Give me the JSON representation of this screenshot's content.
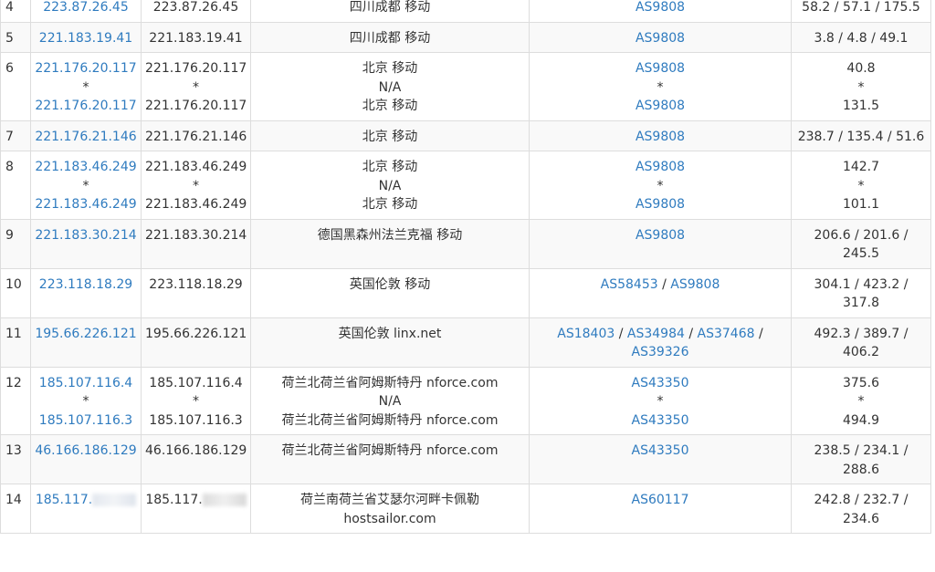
{
  "rows": [
    {
      "hop": "4",
      "ip_link": [
        "223.87.26.45"
      ],
      "ip": [
        "223.87.26.45"
      ],
      "location": [
        "四川成都 移动"
      ],
      "asn": [
        [
          "AS9808"
        ]
      ],
      "latency": [
        "58.2 / 57.1 / 175.5"
      ]
    },
    {
      "hop": "5",
      "ip_link": [
        "221.183.19.41"
      ],
      "ip": [
        "221.183.19.41"
      ],
      "location": [
        "四川成都 移动"
      ],
      "asn": [
        [
          "AS9808"
        ]
      ],
      "latency": [
        "3.8 / 4.8 / 49.1"
      ]
    },
    {
      "hop": "6",
      "ip_link": [
        "221.176.20.117",
        "*",
        "221.176.20.117"
      ],
      "ip": [
        "221.176.20.117",
        "*",
        "221.176.20.117"
      ],
      "location": [
        "北京 移动",
        "N/A",
        "北京 移动"
      ],
      "asn": [
        [
          "AS9808"
        ],
        [
          "*"
        ],
        [
          "AS9808"
        ]
      ],
      "latency": [
        "40.8",
        "*",
        "131.5"
      ]
    },
    {
      "hop": "7",
      "ip_link": [
        "221.176.21.146"
      ],
      "ip": [
        "221.176.21.146"
      ],
      "location": [
        "北京 移动"
      ],
      "asn": [
        [
          "AS9808"
        ]
      ],
      "latency": [
        "238.7 / 135.4 / 51.6"
      ]
    },
    {
      "hop": "8",
      "ip_link": [
        "221.183.46.249",
        "*",
        "221.183.46.249"
      ],
      "ip": [
        "221.183.46.249",
        "*",
        "221.183.46.249"
      ],
      "location": [
        "北京 移动",
        "N/A",
        "北京 移动"
      ],
      "asn": [
        [
          "AS9808"
        ],
        [
          "*"
        ],
        [
          "AS9808"
        ]
      ],
      "latency": [
        "142.7",
        "*",
        "101.1"
      ]
    },
    {
      "hop": "9",
      "ip_link": [
        "221.183.30.214"
      ],
      "ip": [
        "221.183.30.214"
      ],
      "location": [
        "德国黑森州法兰克福 移动"
      ],
      "asn": [
        [
          "AS9808"
        ]
      ],
      "latency": [
        "206.6 / 201.6 /",
        "245.5"
      ]
    },
    {
      "hop": "10",
      "ip_link": [
        "223.118.18.29"
      ],
      "ip": [
        "223.118.18.29"
      ],
      "location": [
        "英国伦敦 移动"
      ],
      "asn": [
        [
          "AS58453",
          "AS9808"
        ]
      ],
      "latency": [
        "304.1 / 423.2 /",
        "317.8"
      ]
    },
    {
      "hop": "11",
      "ip_link": [
        "195.66.226.121"
      ],
      "ip": [
        "195.66.226.121"
      ],
      "location": [
        "英国伦敦 linx.net"
      ],
      "asn": [
        [
          "AS18403",
          "AS34984",
          "AS37468"
        ],
        [
          "AS39326"
        ]
      ],
      "latency": [
        "492.3 / 389.7 /",
        "406.2"
      ]
    },
    {
      "hop": "12",
      "ip_link": [
        "185.107.116.4",
        "*",
        "185.107.116.3"
      ],
      "ip": [
        "185.107.116.4",
        "*",
        "185.107.116.3"
      ],
      "location": [
        "荷兰北荷兰省阿姆斯特丹 nforce.com",
        "N/A",
        "荷兰北荷兰省阿姆斯特丹 nforce.com"
      ],
      "asn": [
        [
          "AS43350"
        ],
        [
          "*"
        ],
        [
          "AS43350"
        ]
      ],
      "latency": [
        "375.6",
        "*",
        "494.9"
      ]
    },
    {
      "hop": "13",
      "ip_link": [
        "46.166.186.129"
      ],
      "ip": [
        "46.166.186.129"
      ],
      "location": [
        "荷兰北荷兰省阿姆斯特丹 nforce.com"
      ],
      "asn": [
        [
          "AS43350"
        ]
      ],
      "latency": [
        "238.5 / 234.1 /",
        "288.6"
      ]
    },
    {
      "hop": "14",
      "ip_link": [
        "185.117."
      ],
      "ip": [
        "185.117."
      ],
      "location": [
        "荷兰南荷兰省艾瑟尔河畔卡佩勒",
        "hostsailor.com"
      ],
      "asn": [
        [
          "AS60117"
        ]
      ],
      "latency": [
        "242.8 / 232.7 /",
        "234.6"
      ]
    }
  ],
  "redacted_rows": [
    "14"
  ],
  "colors": {
    "link": "#2f7bbf",
    "text": "#333333",
    "border": "#dddddd",
    "row_alt": "#f9f9f9"
  }
}
